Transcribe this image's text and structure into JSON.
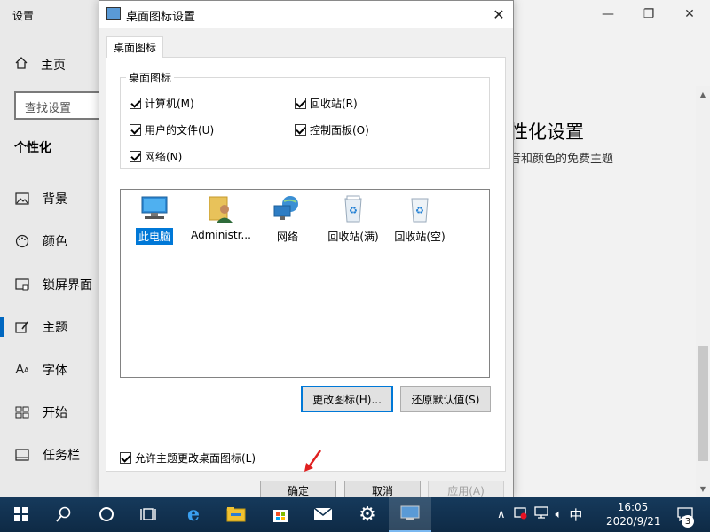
{
  "settings": {
    "title": "设置",
    "home_label": "主页",
    "search_placeholder": "查找设置",
    "section": "个性化",
    "nav": [
      {
        "label": "背景",
        "icon": "picture-icon"
      },
      {
        "label": "颜色",
        "icon": "palette-icon"
      },
      {
        "label": "锁屏界面",
        "icon": "lock-screen-icon"
      },
      {
        "label": "主题",
        "icon": "brush-icon"
      },
      {
        "label": "字体",
        "icon": "font-icon"
      },
      {
        "label": "开始",
        "icon": "start-icon"
      },
      {
        "label": "任务栏",
        "icon": "taskbar-icon"
      }
    ],
    "heading": "性化设置",
    "subtext": "音和颜色的免费主题"
  },
  "dialog": {
    "title": "桌面图标设置",
    "tab": "桌面图标",
    "group_label": "桌面图标",
    "checkboxes": {
      "computer": "计算机(M)",
      "recycle": "回收站(R)",
      "user_files": "用户的文件(U)",
      "control_panel": "控制面板(O)",
      "network": "网络(N)"
    },
    "icons": [
      {
        "label": "此电脑",
        "selected": true
      },
      {
        "label": "Administr...",
        "selected": false
      },
      {
        "label": "网络",
        "selected": false
      },
      {
        "label": "回收站(满)",
        "selected": false
      },
      {
        "label": "回收站(空)",
        "selected": false
      }
    ],
    "change_icon_button": "更改图标(H)...",
    "restore_default_button": "还原默认值(S)",
    "allow_themes_label": "允许主题更改桌面图标(L)",
    "ok_button": "确定",
    "cancel_button": "取消",
    "apply_button": "应用(A)"
  },
  "taskbar": {
    "time": "16:05",
    "date": "2020/9/21",
    "ime": "中",
    "notification_count": "3"
  },
  "colors": {
    "accent": "#0078d7",
    "annotation_arrow": "#e02020"
  }
}
